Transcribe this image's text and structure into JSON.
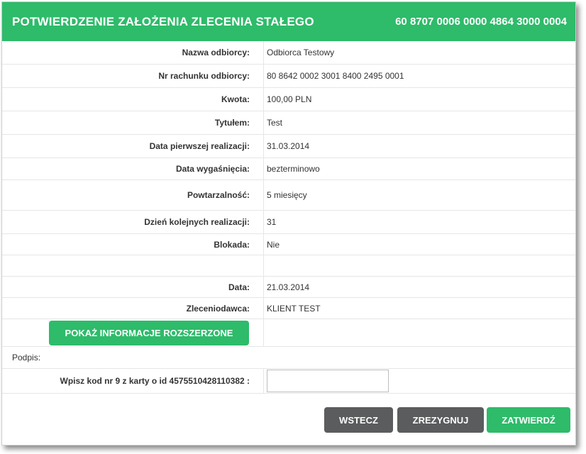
{
  "header": {
    "title": "POTWIERDZENIE ZAŁOŻENIA ZLECENIA STAŁEGO",
    "account": "60 8707 0006 0000 4864 3000 0004"
  },
  "fields": [
    {
      "label": "Nazwa odbiorcy:",
      "value": "Odbiorca Testowy"
    },
    {
      "label": "Nr rachunku odbiorcy:",
      "value": "80 8642 0002 3001 8400 2495 0001"
    },
    {
      "label": "Kwota:",
      "value": "100,00 PLN"
    },
    {
      "label": "Tytułem:",
      "value": "Test"
    },
    {
      "label": "Data pierwszej realizacji:",
      "value": "31.03.2014"
    },
    {
      "label": "Data wygaśnięcia:",
      "value": "bezterminowo"
    },
    {
      "label": "Powtarzalność:",
      "value": "5 miesięcy"
    },
    {
      "label": "Dzień kolejnych realizacji:",
      "value": "31"
    },
    {
      "label": "Blokada:",
      "value": "Nie"
    },
    {
      "label": "Data:",
      "value": "21.03.2014"
    },
    {
      "label": "Zleceniodawca:",
      "value": "KLIENT TEST"
    }
  ],
  "extended_button": "POKAŻ INFORMACJE ROZSZERZONE",
  "signature": {
    "heading": "Podpis:",
    "code_label": "Wpisz kod nr 9 z karty o id 4575510428110382 :",
    "code_value": ""
  },
  "actions": {
    "back": "WSTECZ",
    "cancel": "ZREZYGNUJ",
    "confirm": "ZATWIERDŹ"
  },
  "colors": {
    "accent": "#2ebb6a",
    "secondary_button": "#5a5c5d"
  }
}
